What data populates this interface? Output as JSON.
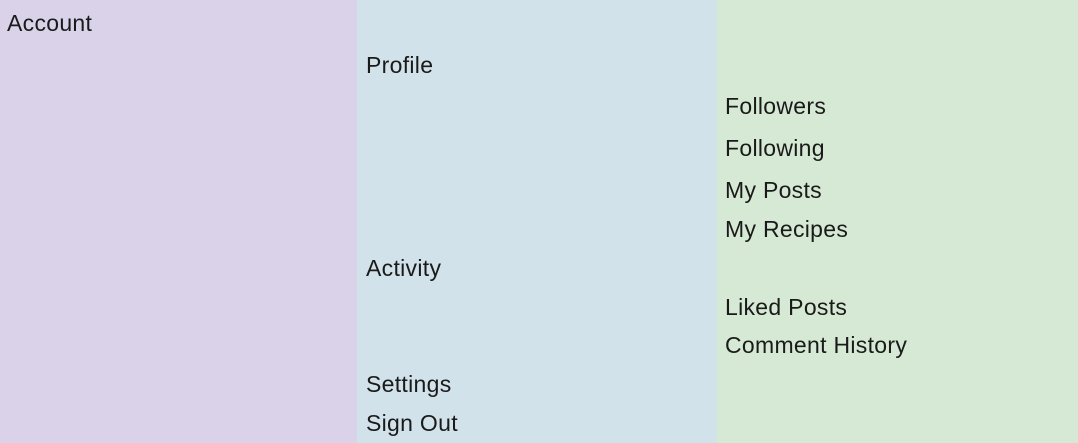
{
  "colors": {
    "level1_bg": "#d9d2e8",
    "level2_bg": "#d1e2ea",
    "level3_bg": "#d6e9d4",
    "text": "#1a1a1a"
  },
  "level1": {
    "account": "Account"
  },
  "level2": {
    "profile": "Profile",
    "activity": "Activity",
    "settings": "Settings",
    "sign_out": "Sign Out"
  },
  "level3": {
    "followers": "Followers",
    "following": "Following",
    "my_posts": "My Posts",
    "my_recipes": "My Recipes",
    "liked_posts": "Liked Posts",
    "comment_history": "Comment History"
  }
}
